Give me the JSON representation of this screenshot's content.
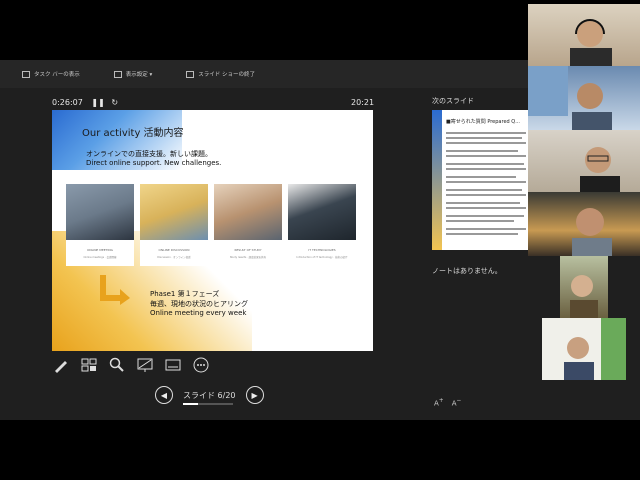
{
  "toolbar": {
    "items": [
      {
        "label": "タスク バーの表示"
      },
      {
        "label": "表示設定 ▾"
      },
      {
        "label": "スライド ショーの終了"
      }
    ]
  },
  "timer": {
    "elapsed": "0:26:07",
    "clock": "20:21"
  },
  "slide": {
    "title": "Our activity 活動内容",
    "subtitle_jp": "オンラインでの直接支援。新しい課題。",
    "subtitle_en": "Direct online support. New challenges.",
    "photos": [
      {
        "caption": "ONLINE MEETING",
        "sub": "Online meetings · 会議開催",
        "color": "#6b7a8a"
      },
      {
        "caption": "ONLINE DISCUSSION",
        "sub": "Discussion · オンライン協議",
        "color": "#d8b25a"
      },
      {
        "caption": "RESULT OF STUDY",
        "sub": "Study results · 調査結果を共有",
        "color": "#b89270"
      },
      {
        "caption": "IT TECHNOLOGIES",
        "sub": "Introduction of IT technology · 技術の紹介",
        "color": "#3a4550"
      }
    ],
    "phase_title": "Phase1 第１フェーズ",
    "phase_jp": "毎週、現地の状況のヒアリング",
    "phase_en": "Online meeting every week"
  },
  "nav": {
    "counter": "スライド 6/20",
    "progress": 0.3
  },
  "next": {
    "label": "次のスライド",
    "title": "■寄せられた質問 Prepared Q..."
  },
  "notes": {
    "text": "ノートはありません。"
  },
  "font": {
    "increase": "A",
    "decrease": "A"
  },
  "colors": {
    "accent_blue": "#2a6bd1",
    "accent_yellow": "#f3c451",
    "arrow": "#e8a21c"
  }
}
